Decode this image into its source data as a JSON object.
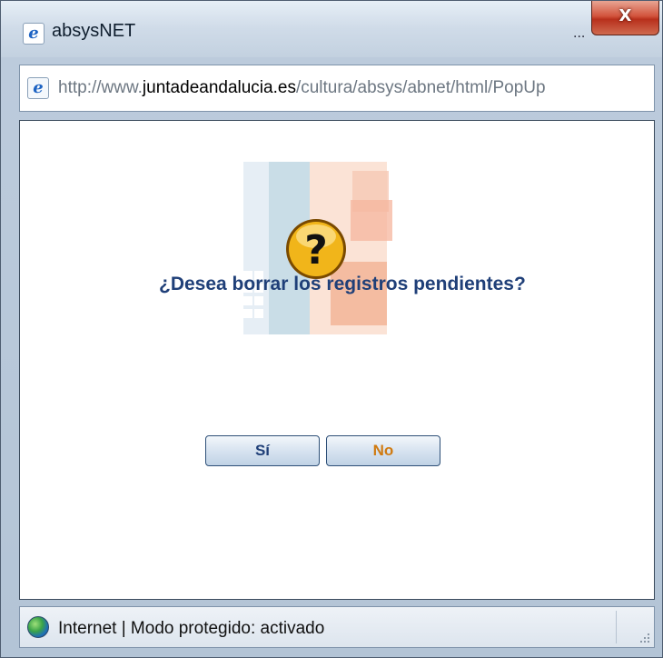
{
  "window": {
    "title": "absysNET",
    "title_dots": "...",
    "close_label": "X"
  },
  "address": {
    "prefix": "http://www.",
    "domain": "juntadeandalucia.es",
    "path": "/cultura/absys/abnet/html/PopUp"
  },
  "dialog": {
    "question": "¿Desea borrar los registros pendientes?",
    "question_mark": "?",
    "yes_label": "Sí",
    "no_label": "No"
  },
  "status": {
    "text": "Internet | Modo protegido: activado"
  },
  "colors": {
    "question_text": "#1f3f78",
    "no_button_text": "#d07a10",
    "close_button": "#c23a22"
  },
  "icons": [
    "ie-icon",
    "close-icon",
    "question-icon",
    "globe-icon",
    "resize-grip-icon"
  ]
}
